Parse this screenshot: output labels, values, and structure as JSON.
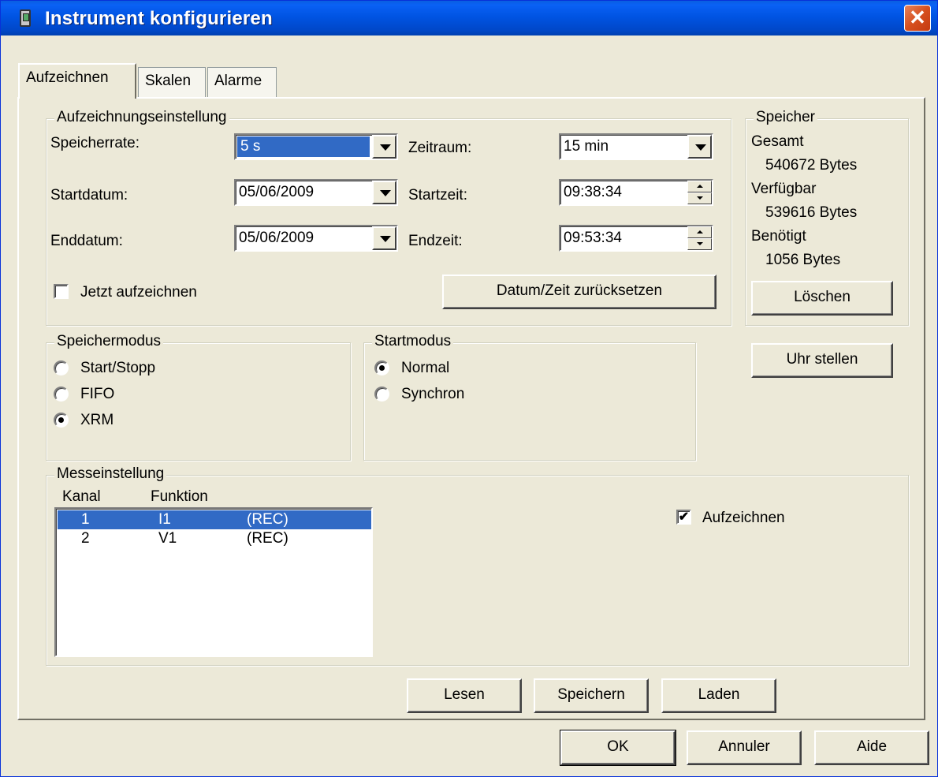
{
  "window": {
    "title": "Instrument konfigurieren",
    "close_glyph": "✕"
  },
  "tabs": [
    {
      "label": "Aufzeichnen",
      "active": true
    },
    {
      "label": "Skalen",
      "active": false
    },
    {
      "label": "Alarme",
      "active": false
    }
  ],
  "recording": {
    "group_label": "Aufzeichnungseinstellung",
    "speicherrate_label": "Speicherrate:",
    "speicherrate_value": "5 s",
    "zeitraum_label": "Zeitraum:",
    "zeitraum_value": "15 min",
    "startdatum_label": "Startdatum:",
    "startdatum_value": "05/06/2009",
    "startzeit_label": "Startzeit:",
    "startzeit_value": "09:38:34",
    "enddatum_label": "Enddatum:",
    "enddatum_value": "05/06/2009",
    "endzeit_label": "Endzeit:",
    "endzeit_value": "09:53:34",
    "record_now_label": "Jetzt aufzeichnen",
    "record_now_checked": false,
    "reset_button": "Datum/Zeit zurücksetzen"
  },
  "memory": {
    "group_label": "Speicher",
    "total_label": "Gesamt",
    "total_value": "540672 Bytes",
    "available_label": "Verfügbar",
    "available_value": "539616 Bytes",
    "required_label": "Benötigt",
    "required_value": "1056 Bytes",
    "delete_button": "Löschen"
  },
  "set_clock_button": "Uhr stellen",
  "storage_mode": {
    "group_label": "Speichermodus",
    "options": [
      "Start/Stopp",
      "FIFO",
      "XRM"
    ],
    "selected": "XRM"
  },
  "start_mode": {
    "group_label": "Startmodus",
    "options": [
      "Normal",
      "Synchron"
    ],
    "selected": "Normal"
  },
  "measurement": {
    "group_label": "Messeinstellung",
    "columns": [
      "Kanal",
      "Funktion"
    ],
    "rows": [
      {
        "kanal": "1",
        "funktion": "I1",
        "status": "(REC)",
        "selected": true
      },
      {
        "kanal": "2",
        "funktion": "V1",
        "status": "(REC)",
        "selected": false
      }
    ],
    "record_label": "Aufzeichnen",
    "record_checked": true
  },
  "panel_buttons": {
    "read": "Lesen",
    "save": "Speichern",
    "load": "Laden"
  },
  "dialog_buttons": {
    "ok": "OK",
    "cancel": "Annuler",
    "help": "Aide"
  },
  "colors": {
    "titlebar": "#0054e3",
    "selection": "#316ac5",
    "face": "#ece9d8"
  }
}
